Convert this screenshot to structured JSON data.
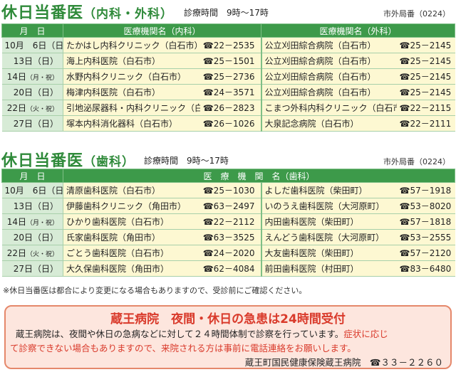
{
  "internal": {
    "title": "休日当番医",
    "title_sub": "（内科・外科）",
    "hours": "診療時間　9時～17時",
    "area_code": "市外局番（0224）",
    "headers": [
      "月　日",
      "医療機関名（内科）",
      "医療機関名（外科）"
    ],
    "rows": [
      {
        "date": "10月　6日（日）",
        "wk": "",
        "a": "たかはし内科クリニック（白石市）",
        "at": "☎22－2535",
        "b": "公立刈田綜合病院（白石市）",
        "bt": "☎25－2145"
      },
      {
        "date": "13日（日）",
        "wk": "",
        "a": "海上内科医院（白石市）",
        "at": "☎25－1501",
        "b": "公立刈田綜合病院（白石市）",
        "bt": "☎25－2145"
      },
      {
        "date": "14日",
        "wk": "（月・祝）",
        "a": "水野内科クリニック（白石市）",
        "at": "☎25－2736",
        "b": "公立刈田綜合病院（白石市）",
        "bt": "☎25－2145"
      },
      {
        "date": "20日（日）",
        "wk": "",
        "a": "梅津内科医院（白石市）",
        "at": "☎24－3571",
        "b": "公立刈田綜合病院（白石市）",
        "bt": "☎25－2145"
      },
      {
        "date": "22日",
        "wk": "（火・祝）",
        "a": "引地泌尿器科・内科クリニック（白石市）",
        "at": "☎26－2823",
        "b": "こまつ外科内科クリニック（白石市）",
        "bt": "☎22－2115"
      },
      {
        "date": "27日（日）",
        "wk": "",
        "a": "塚本内科消化器科（白石市）",
        "at": "☎26－1026",
        "b": "大泉記念病院（白石市）",
        "bt": "☎22－2111"
      }
    ]
  },
  "dental": {
    "title": "休日当番医",
    "title_sub": "（歯科）",
    "hours": "診療時間　9時～17時",
    "area_code": "市外局番（0224）",
    "headers": [
      "月　日",
      "医　療　機　関　名（歯科）"
    ],
    "rows": [
      {
        "date": "10月　6日（日）",
        "wk": "",
        "a": "清原歯科医院（白石市）",
        "at": "☎25－1030",
        "b": "よしだ歯科医院（柴田町）",
        "bt": "☎57－1918"
      },
      {
        "date": "13日（日）",
        "wk": "",
        "a": "伊藤歯科クリニック（角田市）",
        "at": "☎63－2497",
        "b": "いのうえ歯科医院（大河原町）",
        "bt": "☎53－8020"
      },
      {
        "date": "14日",
        "wk": "（月・祝）",
        "a": "ひかり歯科医院（白石市）",
        "at": "☎22－2112",
        "b": "内田歯科医院（柴田町）",
        "bt": "☎57－1818"
      },
      {
        "date": "20日（日）",
        "wk": "",
        "a": "氏家歯科医院（角田市）",
        "at": "☎63－3525",
        "b": "えんどう歯科医院（大河原町）",
        "bt": "☎53－2555"
      },
      {
        "date": "22日",
        "wk": "（火・祝）",
        "a": "ごとう歯科医院（白石市）",
        "at": "☎24－2020",
        "b": "大友歯科医院（柴田町）",
        "bt": "☎57－2120"
      },
      {
        "date": "27日（日）",
        "wk": "",
        "a": "大久保歯科医院（角田市）",
        "at": "☎62－4084",
        "b": "前田歯科医院（村田町）",
        "bt": "☎83－6480"
      }
    ]
  },
  "note": "※休日当番医は都合により変更になる場合もありますので、受診前にご確認ください。",
  "notice": {
    "heading": "蔵王病院　夜間・休日の急患は24時間受付",
    "line1_a": "蔵王病院は、夜間や休日の急病などに対して２４時間体制で診察を行っています。",
    "line1_b": "症状に応じ",
    "line2_a": "て診察できない場合もありますので、来院される方は事前に電話連絡をお願いします。",
    "footer_org": "蔵王町国民健康保険蔵王病院",
    "footer_tel": "☎３３－２２６０"
  }
}
